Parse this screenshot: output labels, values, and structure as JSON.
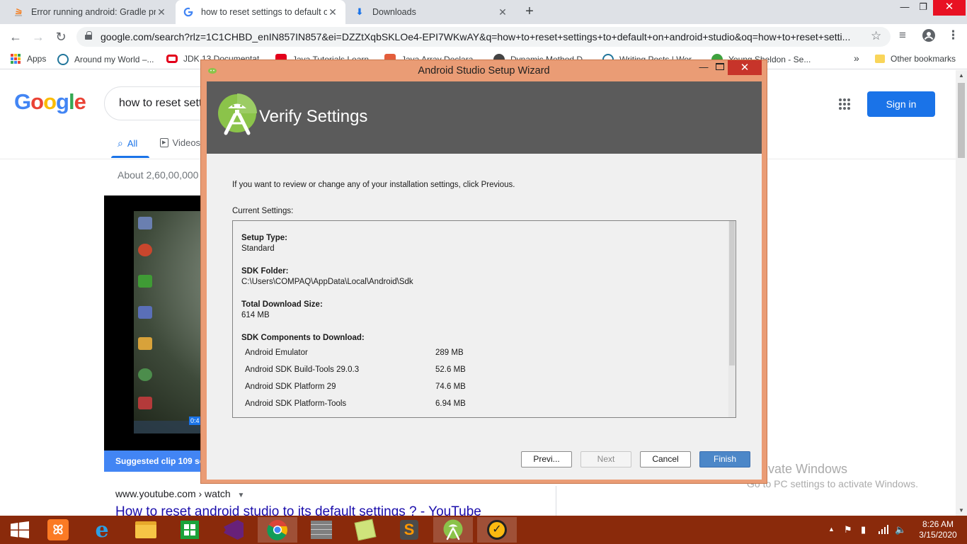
{
  "browser": {
    "tabs": [
      {
        "title": "Error running android: Gradle pro",
        "icon": "stackoverflow-icon"
      },
      {
        "title": "how to reset settings to default o",
        "icon": "google-icon"
      },
      {
        "title": "Downloads",
        "icon": "download-icon"
      }
    ],
    "url": "google.com/search?rlz=1C1CHBD_enIN857IN857&ei=DZZtXqbSKLOe4-EPI7WKwAY&q=how+to+reset+settings+to+default+on+android+studio&oq=how+to+reset+setti...",
    "bookmarks": [
      "Apps",
      "Around my World –...",
      "JDK 13 Documentat",
      "Java Tutorials Learn",
      "Java Array Declara",
      "Dynamic Method D",
      "Writing Posts | Wor",
      "Young Sheldon - Se..."
    ],
    "bookmarks_overflow": "»",
    "other_bookmarks": "Other bookmarks"
  },
  "google": {
    "logo": "Google",
    "query": "how to reset sett",
    "tabs": [
      "All",
      "Videos"
    ],
    "results_count": "About 2,60,00,000",
    "sign_in": "Sign in",
    "suggested_clip": "Suggested clip 109 seconds",
    "video_time": "0:4",
    "cite": "www.youtube.com › watch",
    "result_title": "How to reset android studio to its default settings ? - YouTube"
  },
  "wizard": {
    "window_title": "Android Studio Setup Wizard",
    "heading": "Verify Settings",
    "info": "If you want to review or change any of your installation settings, click Previous.",
    "current_label": "Current Settings:",
    "fields": [
      {
        "label": "Setup Type:",
        "value": "Standard"
      },
      {
        "label": "SDK Folder:",
        "value": "C:\\Users\\COMPAQ\\AppData\\Local\\Android\\Sdk"
      },
      {
        "label": "Total Download Size:",
        "value": "614 MB"
      }
    ],
    "components_label": "SDK Components to Download:",
    "components": [
      {
        "name": "Android Emulator",
        "size": "289 MB"
      },
      {
        "name": "Android SDK Build-Tools 29.0.3",
        "size": "52.6 MB"
      },
      {
        "name": "Android SDK Platform 29",
        "size": "74.6 MB"
      },
      {
        "name": "Android SDK Platform-Tools",
        "size": "6.94 MB"
      }
    ],
    "buttons": {
      "previous": "Previ...",
      "next": "Next",
      "cancel": "Cancel",
      "finish": "Finish"
    }
  },
  "watermark": {
    "line1": "Activate Windows",
    "line2": "Go to PC settings to activate Windows."
  },
  "taskbar": {
    "time": "8:26 AM",
    "date": "3/15/2020"
  },
  "colors": {
    "dialog_frame": "#ea9c75",
    "header_gray": "#5b5b5b",
    "finish_button": "#4c87c8",
    "taskbar": "#8a2a0b",
    "google_blue": "#1a73e8"
  }
}
